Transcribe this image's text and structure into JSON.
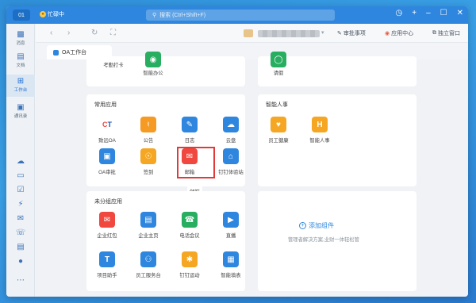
{
  "titlebar": {
    "badge": "01",
    "status": "忙碌中",
    "search_placeholder": "搜索 (Ctrl+Shift+F)"
  },
  "rail": [
    {
      "icon": "message-icon",
      "label": "消息"
    },
    {
      "icon": "doc-icon",
      "label": "文档"
    },
    {
      "icon": "workbench-icon",
      "label": "工作台",
      "active": true
    },
    {
      "icon": "contacts-icon",
      "label": "通讯录"
    }
  ],
  "toolbar": {
    "approval": "审批事项",
    "app_center": "应用中心",
    "standalone": "独立窗口"
  },
  "tab": {
    "label": "OA工作台"
  },
  "top_left_apps": [
    "考勤打卡",
    "智能办公"
  ],
  "top_right_apps": [
    "请假"
  ],
  "common_apps": {
    "title": "常用应用",
    "apps": [
      {
        "label": "致远OA",
        "icon": "zhiyuan-icon",
        "color": "#ffffff",
        "glyph": "CT"
      },
      {
        "label": "公告",
        "icon": "megaphone-icon",
        "color": "#f59a23",
        "glyph": "📢"
      },
      {
        "label": "日志",
        "icon": "log-icon",
        "color": "#2e86de",
        "glyph": "✎"
      },
      {
        "label": "云盘",
        "icon": "cloud-icon",
        "color": "#2e86de",
        "glyph": "☁"
      },
      {
        "label": "OA审批",
        "icon": "stamp-icon",
        "color": "#2e86de",
        "glyph": "▣"
      },
      {
        "label": "签到",
        "icon": "checkin-icon",
        "color": "#f5a623",
        "glyph": "◎"
      },
      {
        "label": "邮箱",
        "icon": "mail-icon",
        "color": "#f0483e",
        "glyph": "✉"
      },
      {
        "label": "钉钉体验站",
        "icon": "experience-icon",
        "color": "#2e86de",
        "glyph": "⌂"
      }
    ],
    "tooltip": "邮箱"
  },
  "smart_hr": {
    "title": "智能人事",
    "apps": [
      {
        "label": "员工健康",
        "icon": "heart-icon",
        "color": "#f5a623",
        "glyph": "♥"
      },
      {
        "label": "智能人事",
        "icon": "hr-icon",
        "color": "#f5a623",
        "glyph": "H"
      }
    ]
  },
  "ungrouped": {
    "title": "未分组应用",
    "apps": [
      {
        "label": "企业红包",
        "icon": "redpacket-icon",
        "color": "#f0483e",
        "glyph": "✉"
      },
      {
        "label": "企业主页",
        "icon": "homepage-icon",
        "color": "#2e86de",
        "glyph": "▤"
      },
      {
        "label": "电话会议",
        "icon": "phone-meeting-icon",
        "color": "#27ae60",
        "glyph": "☎"
      },
      {
        "label": "直播",
        "icon": "live-icon",
        "color": "#2e86de",
        "glyph": "▶"
      },
      {
        "label": "项目助手",
        "icon": "project-icon",
        "color": "#2e86de",
        "glyph": "T"
      },
      {
        "label": "员工服务台",
        "icon": "service-icon",
        "color": "#2e86de",
        "glyph": "⚇"
      },
      {
        "label": "钉钉运动",
        "icon": "sport-icon",
        "color": "#f5a623",
        "glyph": "🏃"
      },
      {
        "label": "智能填表",
        "icon": "form-icon",
        "color": "#2e86de",
        "glyph": "▦"
      }
    ]
  },
  "widget": {
    "add": "添加组件",
    "desc": "管理者解决方案,业财一体轻松管"
  }
}
